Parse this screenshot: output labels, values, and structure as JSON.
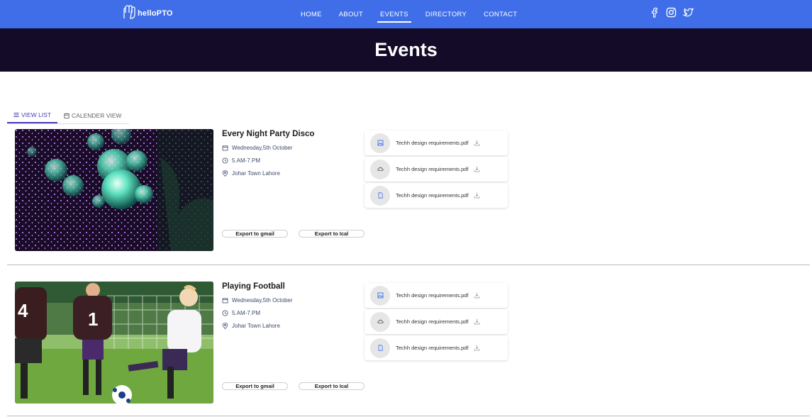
{
  "brand": {
    "logo_text": "helloPTO"
  },
  "nav": {
    "items": [
      "HOME",
      "ABOUT",
      "EVENTS",
      "DIRECTORY",
      "CONTACT"
    ],
    "active": "EVENTS"
  },
  "social": [
    "facebook-icon",
    "instagram-icon",
    "twitter-icon"
  ],
  "hero": {
    "title": "Events"
  },
  "tabs": {
    "list_view": "VIEW LIST",
    "calendar_view": "CALENDER VIEW",
    "active": "VIEW LIST"
  },
  "events": [
    {
      "title": "Every Night Party Disco",
      "date": "Wednesday,5th October",
      "time": "5.AM-7.PM",
      "location": "Johar Town Lahore",
      "export_gmail": "Export to gmail",
      "export_ical": "Export to Ical",
      "files": [
        {
          "icon": "image-file-icon",
          "name": "Techh design requirements.pdf"
        },
        {
          "icon": "cloud-file-icon",
          "name": "Techh design requirements.pdf"
        },
        {
          "icon": "document-file-icon",
          "name": "Techh design requirements.pdf"
        }
      ]
    },
    {
      "title": "Playing Football",
      "date": "Wednesday,5th October",
      "time": "5.AM-7.PM",
      "location": "Johar Town Lahore",
      "export_gmail": "Export to gmail",
      "export_ical": "Export to Ical",
      "files": [
        {
          "icon": "image-file-icon",
          "name": "Techh design requirements.pdf"
        },
        {
          "icon": "cloud-file-icon",
          "name": "Techh design requirements.pdf"
        },
        {
          "icon": "document-file-icon",
          "name": "Techh design requirements.pdf"
        }
      ]
    }
  ],
  "colors": {
    "nav": "#3f6ee8",
    "hero": "#130b27",
    "accent": "#4b3fb5"
  }
}
